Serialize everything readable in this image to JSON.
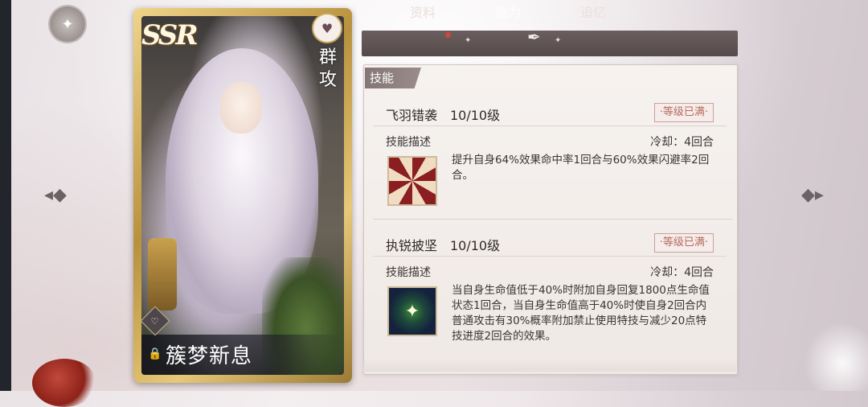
{
  "card": {
    "rarity": "SSR",
    "role_tag": "群攻",
    "name": "簇梦新息",
    "heart_icon": "heartbeat-icon",
    "lock_icon": "lock-icon"
  },
  "tabs": [
    {
      "label": "资料",
      "active": false,
      "has_notification": true
    },
    {
      "label": "能力",
      "active": true
    },
    {
      "label": "追忆",
      "active": false
    }
  ],
  "section": {
    "label": "技能"
  },
  "skills": [
    {
      "name": "飞羽错袭",
      "level": "10/10级",
      "badge": "·等级已满·",
      "desc_label": "技能描述",
      "cooldown": "冷却：4回合",
      "description": "提升自身64%效果命中率1回合与60%效果闪避率2回合。",
      "icon": "red-swirl-skill-icon"
    },
    {
      "name": "执锐披坚",
      "level": "10/10级",
      "badge": "·等级已满·",
      "desc_label": "技能描述",
      "cooldown": "冷却：4回合",
      "description": "当自身生命值低于40%时附加自身回复1800点生命值状态1回合，当自身生命值高于40%时使自身2回合内普通攻击有30%概率附加禁止使用特技与减少20点特技进度2回合的效果。",
      "icon": "star-orb-skill-icon"
    }
  ],
  "colors": {
    "tab_bar": "#5e5253",
    "badge_text": "#b56c5e",
    "notification_dot": "#d2473c",
    "card_frame": "#c9a55a"
  }
}
